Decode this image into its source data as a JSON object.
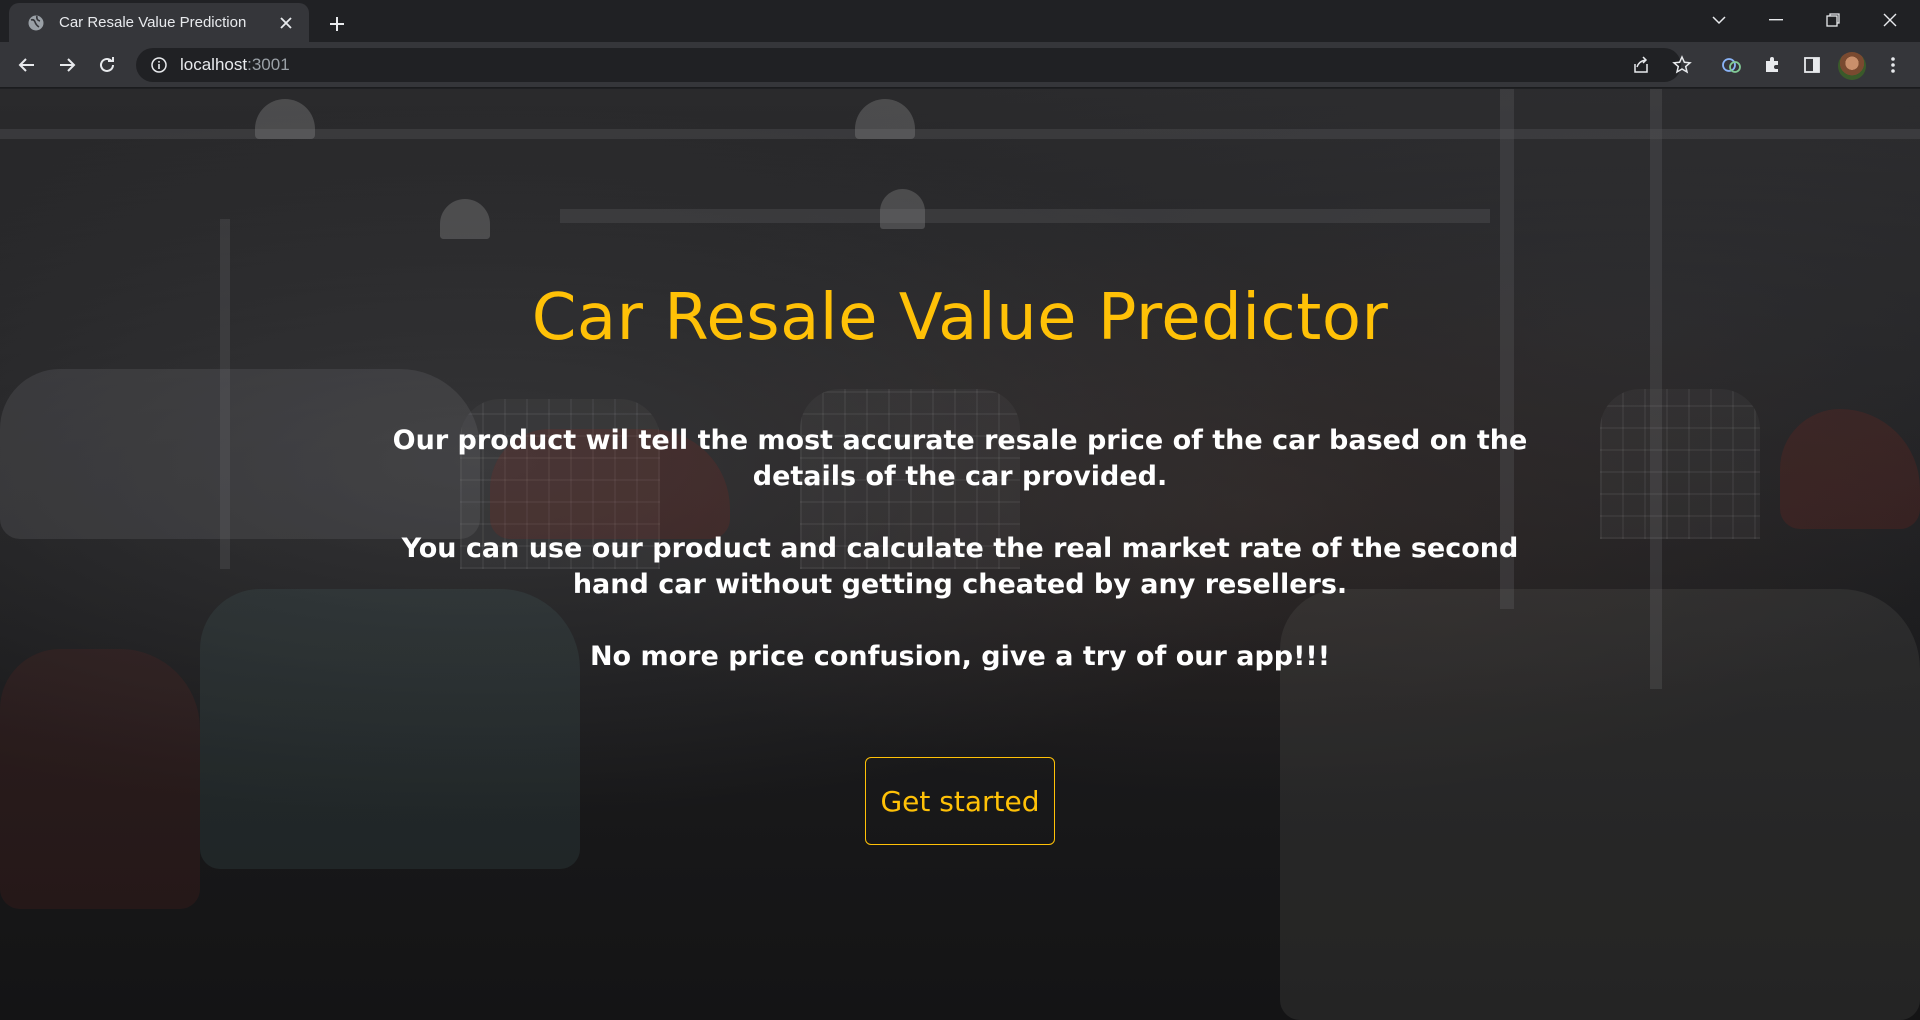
{
  "browser": {
    "tab_title": "Car Resale Value Prediction",
    "url_host": "localhost",
    "url_port": ":3001"
  },
  "page": {
    "heading": "Car Resale Value Predictor",
    "paragraphs": [
      "Our product wil tell the most accurate resale price of the car based on the details of the car provided.",
      "You can use our product and calculate the real market rate of the second hand car without getting cheated by any resellers.",
      "No more price confusion, give a try of our app!!!"
    ],
    "cta_label": "Get started"
  },
  "colors": {
    "accent": "#ffc107",
    "text": "#ffffff",
    "chrome_dark": "#202124",
    "chrome_light": "#35363a"
  },
  "icons": {
    "tab_favicon": "globe-icon",
    "tab_close": "close-icon",
    "new_tab": "plus-icon",
    "back": "arrow-left-icon",
    "forward": "arrow-right-icon",
    "reload": "reload-icon",
    "site_info": "info-icon",
    "share": "share-icon",
    "bookmark": "star-icon",
    "extension_1": "cloud-extension-icon",
    "extensions": "puzzle-icon",
    "side_panel": "side-panel-icon",
    "menu": "kebab-menu-icon"
  }
}
